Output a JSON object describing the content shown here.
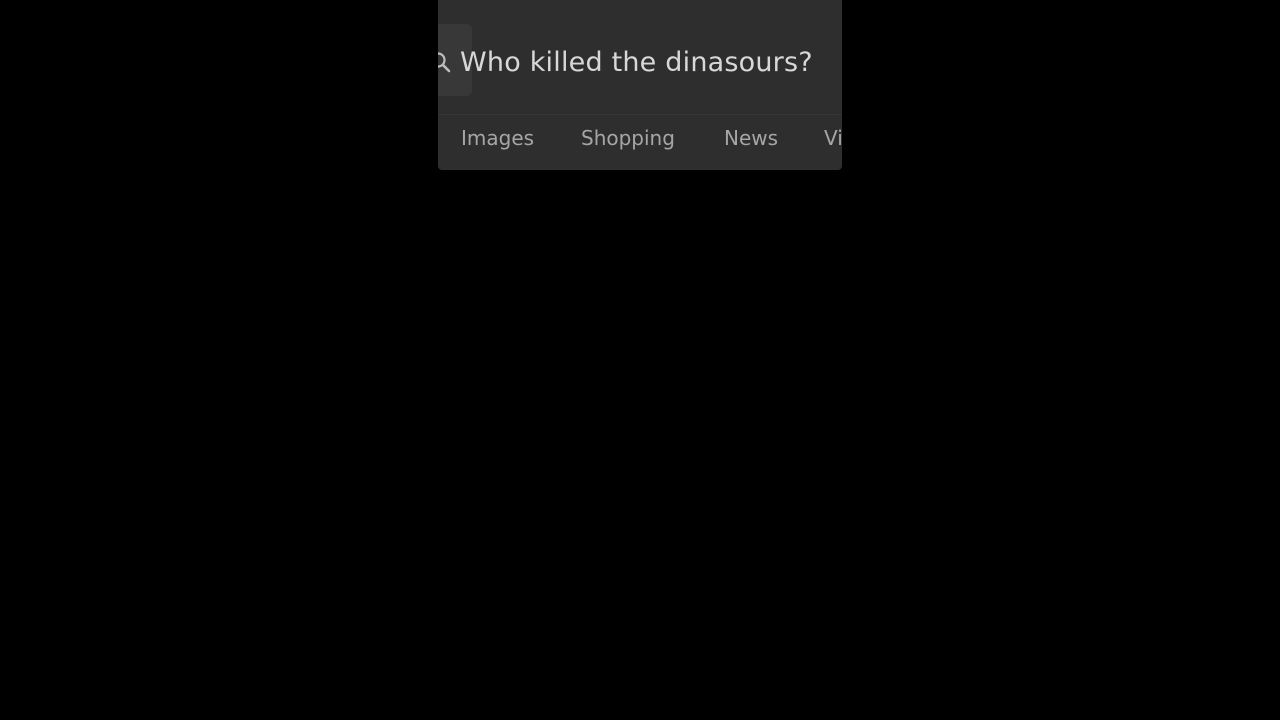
{
  "search": {
    "query": "Who killed the dinasours?",
    "icon": "search-icon"
  },
  "tabs": [
    {
      "label": "Images"
    },
    {
      "label": "Shopping"
    },
    {
      "label": "News"
    },
    {
      "label": "Vi"
    }
  ],
  "colors": {
    "background": "#000000",
    "panel": "#2e2e2e",
    "query_text": "#d8d8d8",
    "tab_text": "#a6a6a6"
  }
}
